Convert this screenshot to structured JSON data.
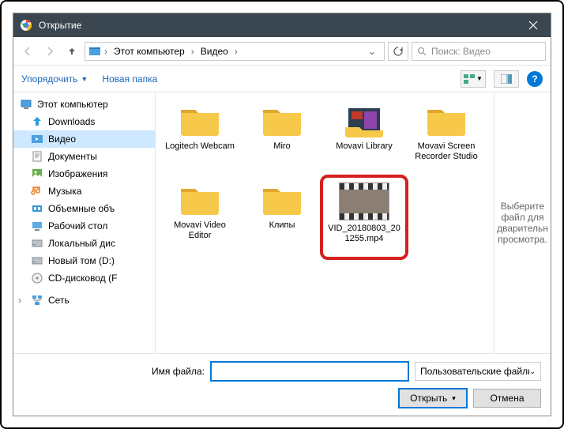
{
  "title": "Открытие",
  "breadcrumb": {
    "root": "Этот компьютер",
    "folder": "Видео"
  },
  "search_placeholder": "Поиск: Видео",
  "toolbar": {
    "organize": "Упорядочить",
    "newfolder": "Новая папка"
  },
  "sidebar": {
    "root": "Этот компьютер",
    "items": [
      "Downloads",
      "Видео",
      "Документы",
      "Изображения",
      "Музыка",
      "Объемные объ",
      "Рабочий стол",
      "Локальный дис",
      "Новый том (D:)",
      "CD-дисковод (F"
    ],
    "network": "Сеть",
    "selected_index": 1
  },
  "files": {
    "folders": [
      "Logitech Webcam",
      "Miro",
      "Movavi Library",
      "Movavi Screen Recorder Studio",
      "Movavi Video Editor",
      "Клипы"
    ],
    "video": "VID_20180803_201255.mp4"
  },
  "preview_text": "Выберите файл для дварительн просмотра.",
  "bottom": {
    "filename_label": "Имя файла:",
    "filename_value": "",
    "filetype": "Пользовательские файлы (*.n",
    "open": "Открыть",
    "cancel": "Отмена"
  }
}
